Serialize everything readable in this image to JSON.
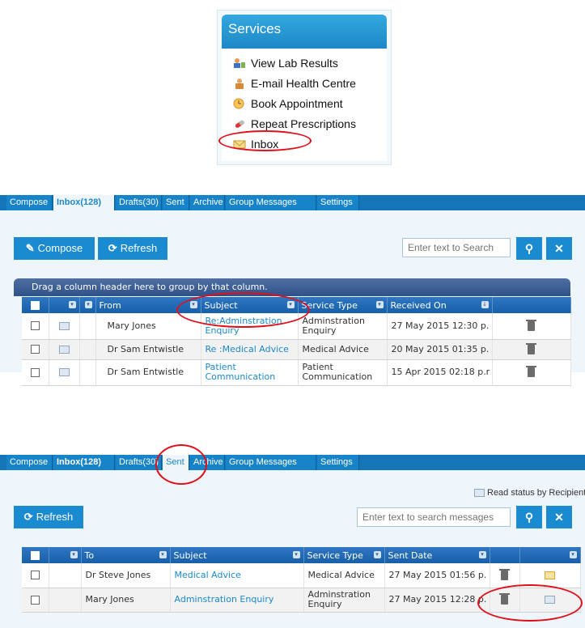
{
  "services": {
    "title": "Services",
    "items": [
      {
        "label": "View Lab Results",
        "icon": "lab-results-icon"
      },
      {
        "label": "E-mail Health Centre",
        "icon": "email-doctor-icon"
      },
      {
        "label": "Book Appointment",
        "icon": "clock-icon"
      },
      {
        "label": "Repeat Prescriptions",
        "icon": "pill-icon"
      },
      {
        "label": "Inbox",
        "icon": "envelope-icon"
      }
    ]
  },
  "inbox_view": {
    "tabs": [
      "Compose",
      "Inbox(128)",
      "Drafts(30)",
      "Sent",
      "Archive",
      "Group Messages",
      "Settings"
    ],
    "active_tab": "Inbox(128)",
    "compose_label": "Compose",
    "refresh_label": "Refresh",
    "search_placeholder": "Enter text to Search",
    "group_hint": "Drag a column header here to group by that column.",
    "columns": [
      "From",
      "Subject",
      "Service Type",
      "Received On"
    ],
    "rows": [
      {
        "from": "Mary Jones",
        "subject": "Re:Adminstration Enquiry",
        "service_type": "Adminstration Enquiry",
        "received": "27 May 2015 12:30 p."
      },
      {
        "from": "Dr Sam Entwistle",
        "subject": "Re :Medical Advice",
        "service_type": "Medical Advice",
        "received": "20 May 2015 01:35 p."
      },
      {
        "from": "Dr Sam Entwistle",
        "subject": "Patient Communication",
        "service_type": "Patient Communication",
        "received": "15 Apr 2015 02:18 p.r"
      }
    ]
  },
  "sent_view": {
    "tabs": [
      "Compose",
      "Inbox(128)",
      "Drafts(30)",
      "Sent",
      "Archive",
      "Group Messages",
      "Settings"
    ],
    "active_tab": "Sent",
    "read_status_label": "Read status by Recipient",
    "refresh_label": "Refresh",
    "search_placeholder": "Enter text to search messages",
    "columns": [
      "To",
      "Subject",
      "Service Type",
      "Sent Date"
    ],
    "rows": [
      {
        "to": "Dr Steve Jones",
        "subject": "Medical Advice",
        "service_type": "Medical Advice",
        "sent": "27 May 2015 01:56 p."
      },
      {
        "to": "Mary Jones",
        "subject": "Adminstration Enquiry",
        "service_type": "Adminstration Enquiry",
        "sent": "27 May 2015 12:28 p."
      }
    ]
  },
  "colors": {
    "accent": "#1a8ad1",
    "tab_bar": "#1475b9",
    "highlight_circle": "#e0101a"
  }
}
